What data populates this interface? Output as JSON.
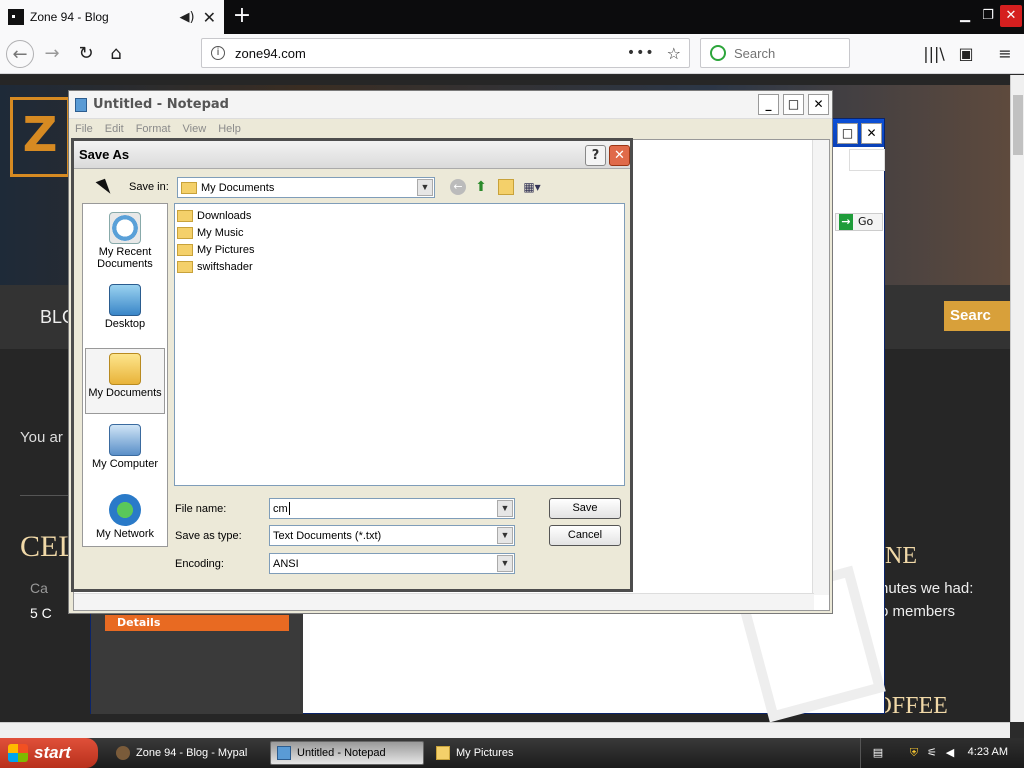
{
  "browser": {
    "tab_title": "Zone 94 - Blog",
    "url": "zone94.com",
    "search_placeholder": "Search",
    "new_tab_label": "+",
    "url_menu_dots": "•••"
  },
  "website": {
    "logo_letter": "Z",
    "nav_blog": "BLO",
    "search_tab": "Searc",
    "you_are": "You ar",
    "heading_left": "CEL",
    "category": "Ca",
    "comments": "5 C",
    "heading_right": "NE",
    "minutes_text": "nutes we had:",
    "members_text": "o members",
    "bottom_heading": "BUY ME A COFFEE",
    "details_label": "Details",
    "go_label": "Go"
  },
  "notepad": {
    "title": "Untitled - Notepad",
    "menu": [
      "File",
      "Edit",
      "Format",
      "View",
      "Help"
    ]
  },
  "save_as": {
    "title": "Save As",
    "help_label": "?",
    "close_label": "✕",
    "save_in_label": "Save in:",
    "save_in_value": "My Documents",
    "places": [
      {
        "label": "My Recent Documents",
        "icon": "recent-documents-icon"
      },
      {
        "label": "Desktop",
        "icon": "desktop-icon"
      },
      {
        "label": "My Documents",
        "icon": "my-documents-icon"
      },
      {
        "label": "My Computer",
        "icon": "my-computer-icon"
      },
      {
        "label": "My Network",
        "icon": "my-network-icon"
      }
    ],
    "files": [
      "Downloads",
      "My Music",
      "My Pictures",
      "swiftshader"
    ],
    "file_name_label": "File name:",
    "file_name_value": "cm",
    "save_as_type_label": "Save as type:",
    "save_as_type_value": "Text Documents (*.txt)",
    "encoding_label": "Encoding:",
    "encoding_value": "ANSI",
    "save_button": "Save",
    "cancel_button": "Cancel"
  },
  "taskbar": {
    "start_label": "start",
    "tasks": [
      "Zone 94 - Blog - Mypal",
      "Untitled - Notepad",
      "My Pictures"
    ],
    "time": "4:23 AM"
  },
  "colors": {
    "xp_blue": "#0b4fd6",
    "start_red": "#c0392b",
    "firefox_dark": "#0c0c0d"
  }
}
